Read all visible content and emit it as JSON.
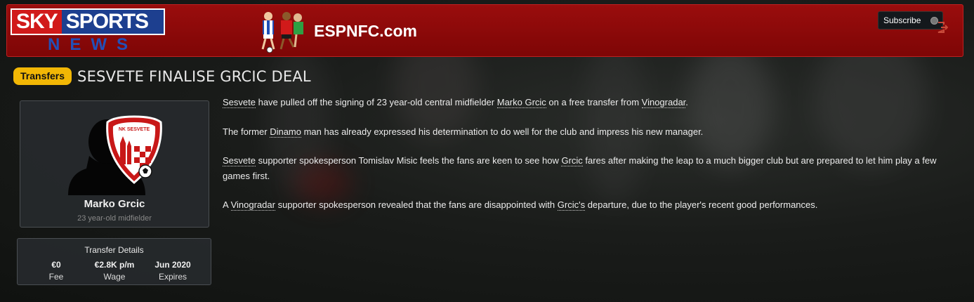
{
  "banner": {
    "logo_sky": "SKY",
    "logo_sports": "SPORTS",
    "logo_news": "NEWS",
    "site": "ESPNFC.com",
    "subscribe_label": "Subscribe"
  },
  "article": {
    "category": "Transfers",
    "headline": "SESVETE FINALISE GRCIC DEAL",
    "paragraphs": [
      [
        {
          "t": "Sesvete",
          "link": true
        },
        {
          "t": " have pulled off the signing of 23 year-old central midfielder "
        },
        {
          "t": "Marko Grcic",
          "link": true
        },
        {
          "t": " on a free transfer from "
        },
        {
          "t": "Vinogradar",
          "link": true
        },
        {
          "t": "."
        }
      ],
      [
        {
          "t": "The former "
        },
        {
          "t": "Dinamo",
          "link": true
        },
        {
          "t": " man has already expressed his determination to do well for the club and impress his new manager."
        }
      ],
      [
        {
          "t": "Sesvete",
          "link": true
        },
        {
          "t": " supporter spokesperson Tomislav Misic feels the fans are keen to see how "
        },
        {
          "t": "Grcic",
          "link": true
        },
        {
          "t": " fares after making the leap to a much bigger club but are prepared to let him play a few games first."
        }
      ],
      [
        {
          "t": "A "
        },
        {
          "t": "Vinogradar",
          "link": true
        },
        {
          "t": " supporter spokesperson revealed that the fans are disappointed with "
        },
        {
          "t": "Grcic's",
          "link": true
        },
        {
          "t": " departure, due to the player's recent good performances."
        }
      ]
    ]
  },
  "player": {
    "name": "Marko Grcic",
    "description": "23 year-old midfielder",
    "club_crest_text": "NK SESVETE"
  },
  "transfer": {
    "title": "Transfer Details",
    "fee_value": "€0",
    "fee_label": "Fee",
    "wage_value": "€2.8K p/m",
    "wage_label": "Wage",
    "expires_value": "Jun 2020",
    "expires_label": "Expires"
  },
  "colors": {
    "banner_red": "#8a0a0a",
    "badge_yellow": "#f2b705",
    "sky_red": "#d11a1a",
    "sky_blue": "#1d3f8f"
  },
  "icons": [
    "football-players-icon",
    "exit-icon",
    "player-silhouette-icon",
    "club-crest-icon"
  ]
}
